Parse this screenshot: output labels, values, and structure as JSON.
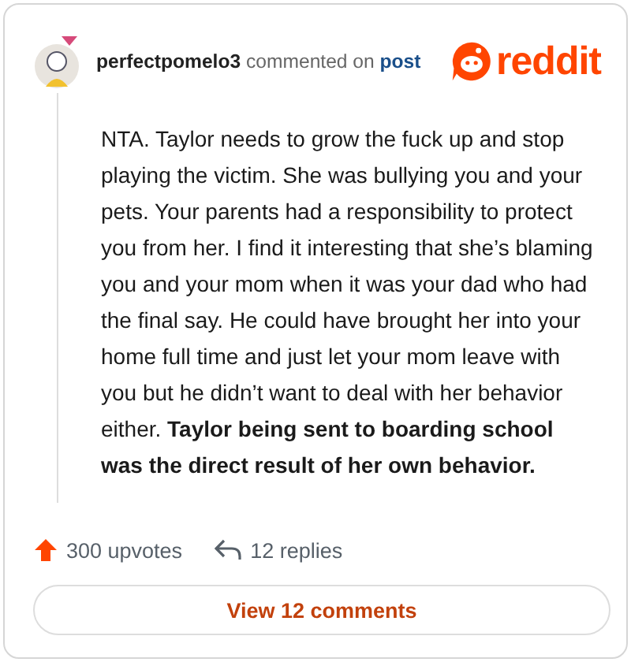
{
  "comment": {
    "author": "perfectpomelo3",
    "action": "commented on",
    "target": "post",
    "body": "NTA. Taylor needs to grow the fuck up and stop playing the victim. She was bullying you and your pets. Your parents had a responsibility to protect you from her. I find it interesting that she’s blaming you and your mom when it was your dad who had the final say. He could have brought her into your home full time and just let your mom leave with you but he didn’t want to deal with her behavior either. **Taylor being sent to boarding school was the direct result of her own behavior.**"
  },
  "logo": {
    "text": "reddit"
  },
  "stats": [
    {
      "kind": "upvotes",
      "label": "300 upvotes"
    },
    {
      "kind": "replies",
      "label": "12 replies"
    }
  ],
  "button": {
    "label": "View 12 comments"
  }
}
